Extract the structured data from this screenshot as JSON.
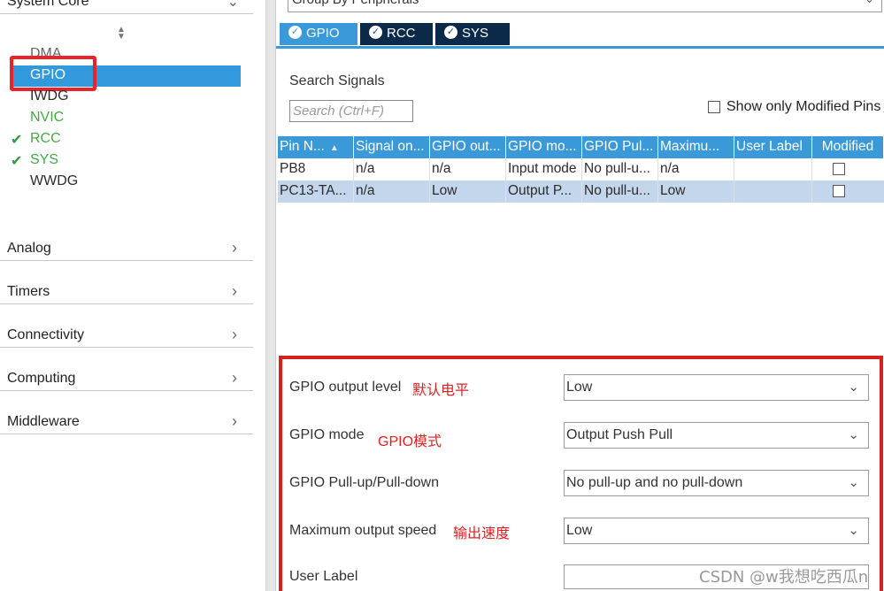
{
  "left": {
    "system_core_label": "System Core",
    "peripherals": [
      {
        "name": "DMA",
        "checked": false
      },
      {
        "name": "GPIO",
        "checked": false
      },
      {
        "name": "IWDG",
        "checked": false
      },
      {
        "name": "NVIC",
        "checked": false
      },
      {
        "name": "RCC",
        "checked": true
      },
      {
        "name": "SYS",
        "checked": true
      },
      {
        "name": "WWDG",
        "checked": false
      }
    ],
    "categories": [
      "Analog",
      "Timers",
      "Connectivity",
      "Computing",
      "Middleware"
    ]
  },
  "right": {
    "group_by": "Group By Peripherals",
    "tabs": [
      "GPIO",
      "RCC",
      "SYS"
    ],
    "search_label": "Search Signals",
    "search_placeholder": "Search (Ctrl+F)",
    "show_modified": "Show only Modified Pins",
    "table": {
      "headers": [
        "Pin N...",
        "Signal on...",
        "GPIO out...",
        "GPIO mo...",
        "GPIO Pul...",
        "Maximu...",
        "User Label",
        "Modified"
      ],
      "rows": [
        [
          "PB8",
          "n/a",
          "n/a",
          "Input mode",
          "No pull-u...",
          "n/a",
          "",
          ""
        ],
        [
          "PC13-TA...",
          "n/a",
          "Low",
          "Output P...",
          "No pull-u...",
          "Low",
          "",
          ""
        ]
      ]
    },
    "properties": {
      "output_level": {
        "label": "GPIO output level",
        "annotation": "默认电平",
        "value": "Low"
      },
      "mode": {
        "label": "GPIO mode",
        "annotation": "GPIO模式",
        "value": "Output Push Pull"
      },
      "pull": {
        "label": "GPIO Pull-up/Pull-down",
        "value": "No pull-up and no pull-down"
      },
      "speed": {
        "label": "Maximum output speed",
        "annotation": "输出速度",
        "value": "Low"
      },
      "user_label": {
        "label": "User Label",
        "value": ""
      }
    }
  },
  "watermark": "CSDN @w我想吃西瓜n",
  "colors": {
    "accent": "#3a9ad9",
    "selection": "#3399dd",
    "annotation": "#e02020",
    "ok_green": "#2e9a3c"
  }
}
